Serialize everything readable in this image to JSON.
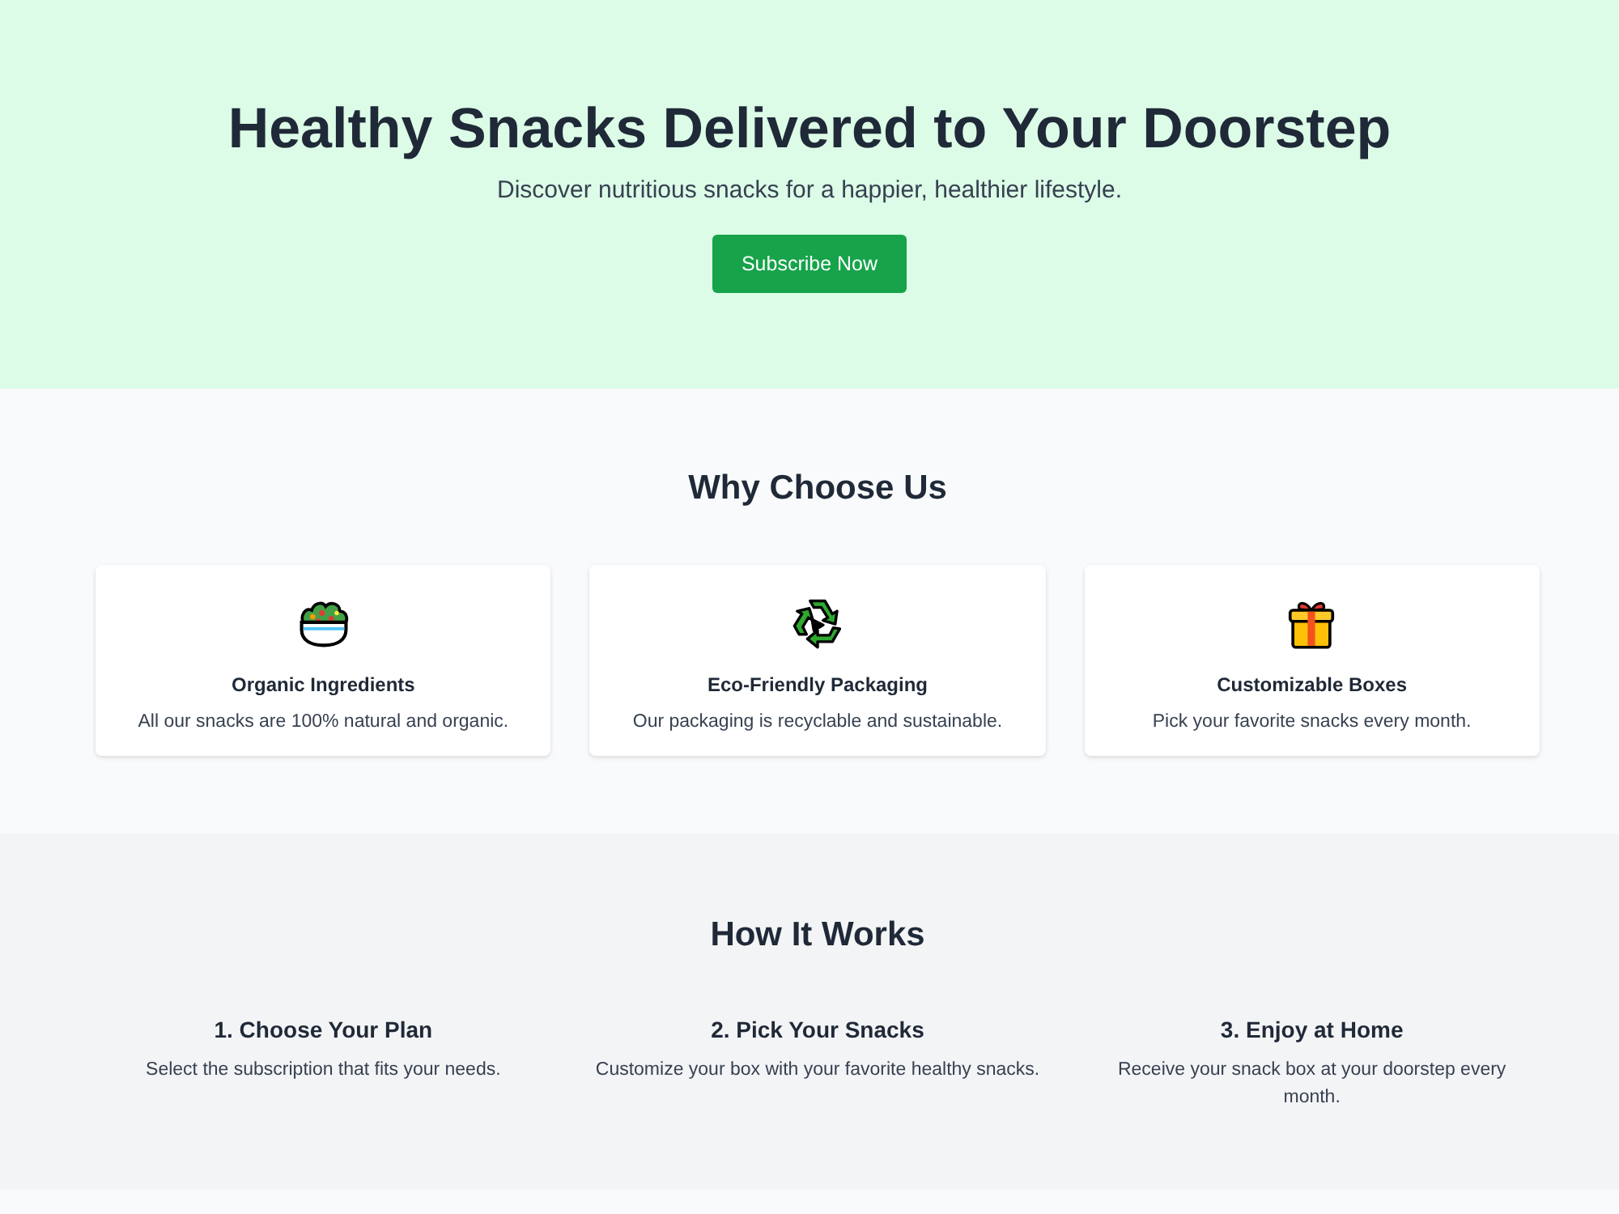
{
  "hero": {
    "title": "Healthy Snacks Delivered to Your Doorstep",
    "subtitle": "Discover nutritious snacks for a happier, healthier lifestyle.",
    "button": "Subscribe Now"
  },
  "features": {
    "heading": "Why Choose Us",
    "cards": [
      {
        "title": "Organic Ingredients",
        "description": "All our snacks are 100% natural and organic."
      },
      {
        "title": "Eco-Friendly Packaging",
        "description": "Our packaging is recyclable and sustainable."
      },
      {
        "title": "Customizable Boxes",
        "description": "Pick your favorite snacks every month."
      }
    ]
  },
  "steps": {
    "heading": "How It Works",
    "items": [
      {
        "title": "1. Choose Your Plan",
        "description": "Select the subscription that fits your needs."
      },
      {
        "title": "2. Pick Your Snacks",
        "description": "Customize your box with your favorite healthy snacks."
      },
      {
        "title": "3. Enjoy at Home",
        "description": "Receive your snack box at your doorstep every month."
      }
    ]
  }
}
